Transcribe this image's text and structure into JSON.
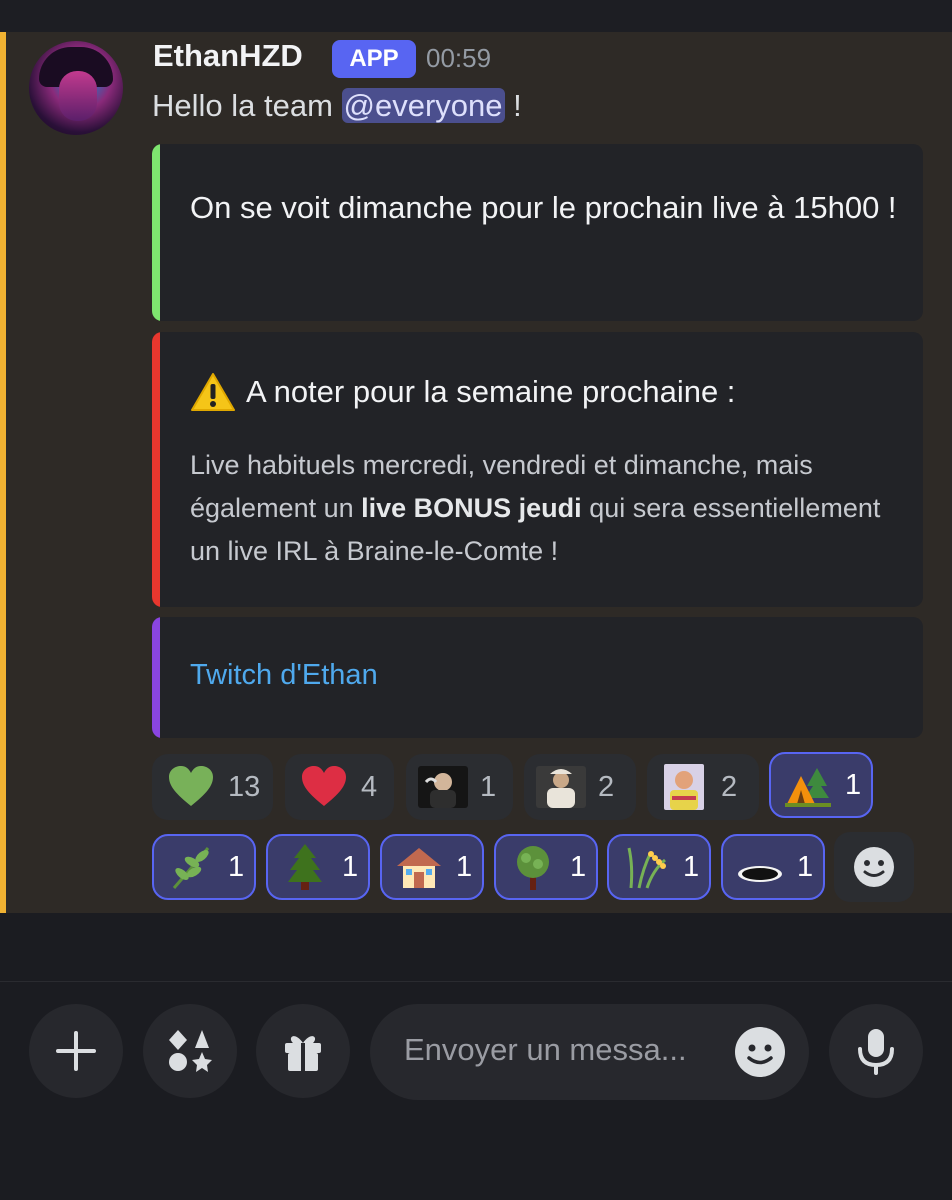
{
  "message": {
    "author": "EthanHZD",
    "badge": "APP",
    "time": "00:59",
    "text_prefix": "Hello la team ",
    "mention": "@everyone",
    "text_suffix": " !",
    "mention_color": "#f0b232"
  },
  "embeds": [
    {
      "accent": "#7ee56f",
      "description": "On se voit dimanche pour le prochain live à 15h00 !"
    },
    {
      "accent": "#e8372e",
      "title_icon": "warning-icon",
      "title": "A noter pour la semaine prochaine :",
      "body_before": "Live habituels mercredi, vendredi et dimanche, mais également un ",
      "body_bold": "live BONUS jeudi",
      "body_after": " qui sera essentiellement un live IRL à Braine-le-Comte !"
    },
    {
      "accent": "#8a45e0",
      "link": "Twitch d'Ethan"
    }
  ],
  "reactions": [
    {
      "emoji": "green-heart-icon",
      "count": "13",
      "active": false
    },
    {
      "emoji": "red-heart-icon",
      "count": "4",
      "active": false
    },
    {
      "emoji": "custom-emoji-photo-1",
      "count": "1",
      "active": false
    },
    {
      "emoji": "custom-emoji-photo-2",
      "count": "2",
      "active": false
    },
    {
      "emoji": "custom-emoji-photo-3",
      "count": "2",
      "active": false
    },
    {
      "emoji": "camping-icon",
      "count": "1",
      "active": true
    },
    {
      "emoji": "herb-icon",
      "count": "1",
      "active": true
    },
    {
      "emoji": "evergreen-tree-icon",
      "count": "1",
      "active": true
    },
    {
      "emoji": "house-icon",
      "count": "1",
      "active": true
    },
    {
      "emoji": "deciduous-tree-icon",
      "count": "1",
      "active": true
    },
    {
      "emoji": "rice-ear-icon",
      "count": "1",
      "active": true
    },
    {
      "emoji": "hole-icon",
      "count": "1",
      "active": true
    }
  ],
  "composer": {
    "placeholder": "Envoyer un messa..."
  }
}
